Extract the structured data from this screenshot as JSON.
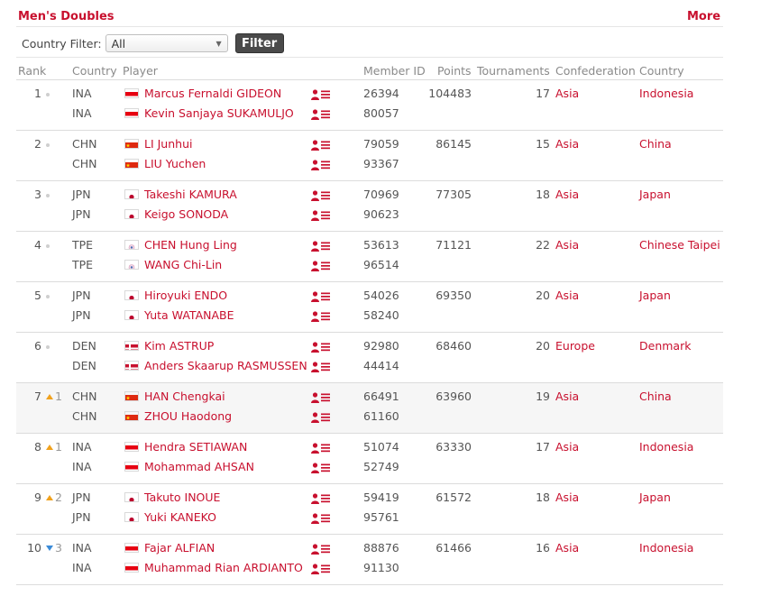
{
  "section": {
    "title": "Men's Doubles",
    "more_label": "More"
  },
  "filter": {
    "label": "Country Filter:",
    "selected": "All",
    "button_label": "Filter"
  },
  "columns": {
    "rank": "Rank",
    "country": "Country",
    "player": "Player",
    "member_id": "Member ID",
    "points": "Points",
    "tournaments": "Tournaments",
    "confederation": "Confederation",
    "country_name": "Country"
  },
  "colors": {
    "accent": "#c8102e",
    "rise": "#f0a11c",
    "fall": "#3b8bd8",
    "filter_button": "#4a4a4a"
  },
  "rankings": [
    {
      "rank": "1",
      "trend": "same",
      "change": "",
      "points": "104483",
      "tournaments": "17",
      "confederation": "Asia",
      "country_name": "Indonesia",
      "players": [
        {
          "code": "INA",
          "flag": "indonesia-flag",
          "name": "Marcus Fernaldi GIDEON",
          "member_id": "26394"
        },
        {
          "code": "INA",
          "flag": "indonesia-flag",
          "name": "Kevin Sanjaya SUKAMULJO",
          "member_id": "80057"
        }
      ]
    },
    {
      "rank": "2",
      "trend": "same",
      "change": "",
      "points": "86145",
      "tournaments": "15",
      "confederation": "Asia",
      "country_name": "China",
      "players": [
        {
          "code": "CHN",
          "flag": "china-flag",
          "name": "LI Junhui",
          "member_id": "79059"
        },
        {
          "code": "CHN",
          "flag": "china-flag",
          "name": "LIU Yuchen",
          "member_id": "93367"
        }
      ]
    },
    {
      "rank": "3",
      "trend": "same",
      "change": "",
      "points": "77305",
      "tournaments": "18",
      "confederation": "Asia",
      "country_name": "Japan",
      "players": [
        {
          "code": "JPN",
          "flag": "japan-flag",
          "name": "Takeshi KAMURA",
          "member_id": "70969"
        },
        {
          "code": "JPN",
          "flag": "japan-flag",
          "name": "Keigo SONODA",
          "member_id": "90623"
        }
      ]
    },
    {
      "rank": "4",
      "trend": "same",
      "change": "",
      "points": "71121",
      "tournaments": "22",
      "confederation": "Asia",
      "country_name": "Chinese Taipei",
      "players": [
        {
          "code": "TPE",
          "flag": "chinese-taipei-flag",
          "name": "CHEN Hung Ling",
          "member_id": "53613"
        },
        {
          "code": "TPE",
          "flag": "chinese-taipei-flag",
          "name": "WANG Chi-Lin",
          "member_id": "96514"
        }
      ]
    },
    {
      "rank": "5",
      "trend": "same",
      "change": "",
      "points": "69350",
      "tournaments": "20",
      "confederation": "Asia",
      "country_name": "Japan",
      "players": [
        {
          "code": "JPN",
          "flag": "japan-flag",
          "name": "Hiroyuki ENDO",
          "member_id": "54026"
        },
        {
          "code": "JPN",
          "flag": "japan-flag",
          "name": "Yuta WATANABE",
          "member_id": "58240"
        }
      ]
    },
    {
      "rank": "6",
      "trend": "same",
      "change": "",
      "points": "68460",
      "tournaments": "20",
      "confederation": "Europe",
      "country_name": "Denmark",
      "players": [
        {
          "code": "DEN",
          "flag": "denmark-flag",
          "name": "Kim ASTRUP",
          "member_id": "92980"
        },
        {
          "code": "DEN",
          "flag": "denmark-flag",
          "name": "Anders Skaarup RASMUSSEN",
          "member_id": "44414"
        }
      ]
    },
    {
      "rank": "7",
      "trend": "up",
      "change": "1",
      "points": "63960",
      "tournaments": "19",
      "confederation": "Asia",
      "country_name": "China",
      "players": [
        {
          "code": "CHN",
          "flag": "china-flag",
          "name": "HAN Chengkai",
          "member_id": "66491"
        },
        {
          "code": "CHN",
          "flag": "china-flag",
          "name": "ZHOU Haodong",
          "member_id": "61160"
        }
      ]
    },
    {
      "rank": "8",
      "trend": "up",
      "change": "1",
      "points": "63330",
      "tournaments": "17",
      "confederation": "Asia",
      "country_name": "Indonesia",
      "players": [
        {
          "code": "INA",
          "flag": "indonesia-flag",
          "name": "Hendra SETIAWAN",
          "member_id": "51074"
        },
        {
          "code": "INA",
          "flag": "indonesia-flag",
          "name": "Mohammad AHSAN",
          "member_id": "52749"
        }
      ]
    },
    {
      "rank": "9",
      "trend": "up",
      "change": "2",
      "points": "61572",
      "tournaments": "18",
      "confederation": "Asia",
      "country_name": "Japan",
      "players": [
        {
          "code": "JPN",
          "flag": "japan-flag",
          "name": "Takuto INOUE",
          "member_id": "59419"
        },
        {
          "code": "JPN",
          "flag": "japan-flag",
          "name": "Yuki KANEKO",
          "member_id": "95761"
        }
      ]
    },
    {
      "rank": "10",
      "trend": "down",
      "change": "3",
      "points": "61466",
      "tournaments": "16",
      "confederation": "Asia",
      "country_name": "Indonesia",
      "players": [
        {
          "code": "INA",
          "flag": "indonesia-flag",
          "name": "Fajar ALFIAN",
          "member_id": "88876"
        },
        {
          "code": "INA",
          "flag": "indonesia-flag",
          "name": "Muhammad Rian ARDIANTO",
          "member_id": "91130"
        }
      ]
    }
  ]
}
